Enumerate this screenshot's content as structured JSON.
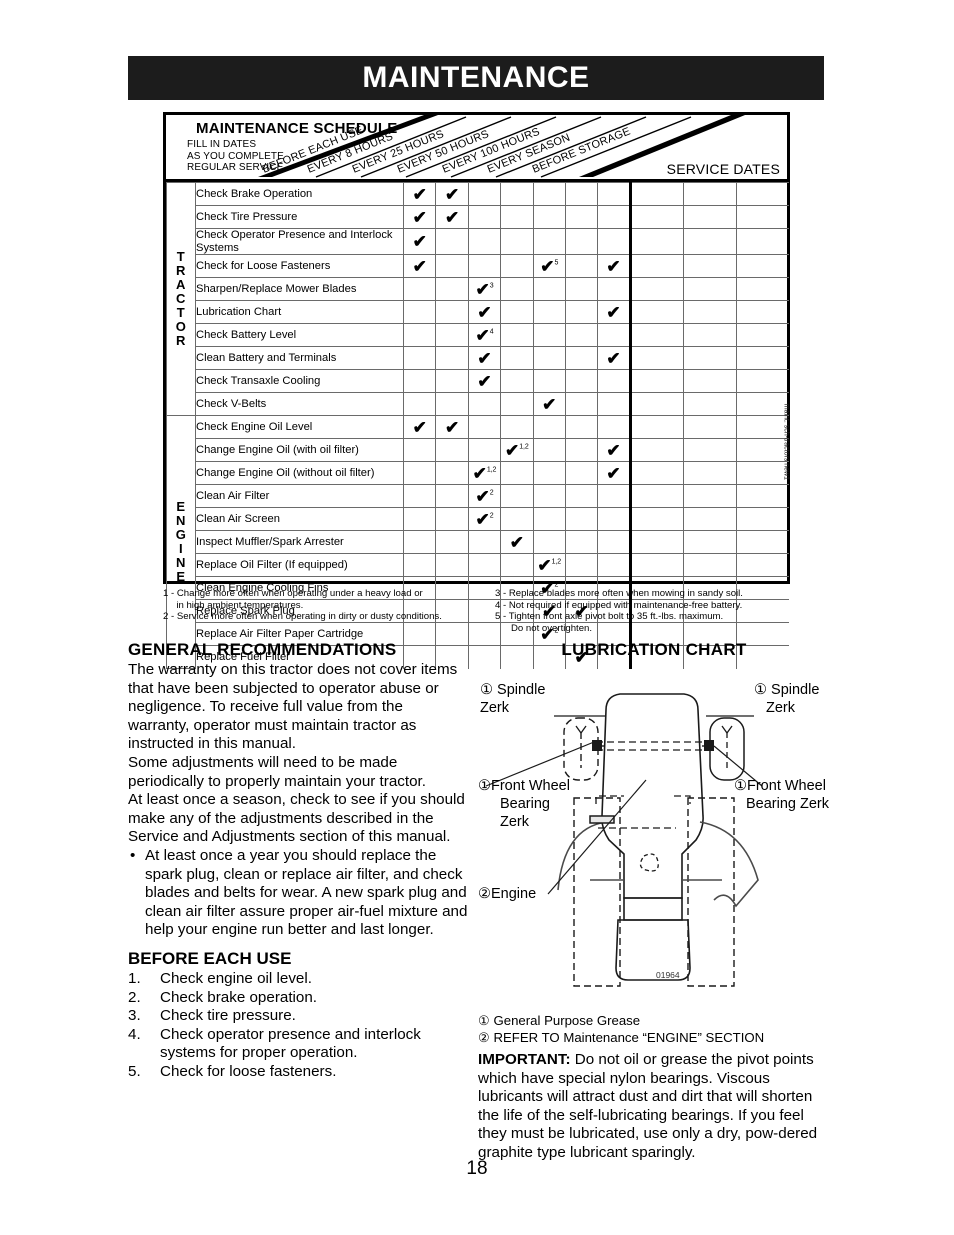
{
  "page": {
    "banner_title": "MAINTENANCE",
    "page_number": "18",
    "side_code": "maint. sch-tractors new1"
  },
  "schedule": {
    "title": "MAINTENANCE SCHEDULE",
    "subtitle_lines": [
      "FILL IN DATES",
      "AS YOU COMPLETE",
      "REGULAR SERVICE"
    ],
    "service_dates_label": "SERVICE DATES",
    "column_headers": [
      "BEFORE EACH USE",
      "EVERY 8 HOURS",
      "EVERY 25 HOURS",
      "EVERY 50 HOURS",
      "EVERY 100 HOURS",
      "EVERY SEASON",
      "BEFORE STORAGE"
    ],
    "sections": [
      {
        "label": "TRACTOR",
        "rows": [
          {
            "task": "Check Brake Operation",
            "checks": [
              {
                "col": 0
              },
              {
                "col": 1
              }
            ]
          },
          {
            "task": "Check Tire Pressure",
            "checks": [
              {
                "col": 0
              },
              {
                "col": 1
              }
            ]
          },
          {
            "task": "Check Operator Presence and Interlock Systems",
            "checks": [
              {
                "col": 0
              }
            ]
          },
          {
            "task": "Check for Loose Fasteners",
            "checks": [
              {
                "col": 0
              },
              {
                "col": 4,
                "note": "5"
              },
              {
                "col": 6
              }
            ]
          },
          {
            "task": "Sharpen/Replace Mower Blades",
            "checks": [
              {
                "col": 2,
                "note": "3"
              }
            ]
          },
          {
            "task": "Lubrication Chart",
            "checks": [
              {
                "col": 2
              },
              {
                "col": 6
              }
            ]
          },
          {
            "task": "Check Battery Level",
            "checks": [
              {
                "col": 2,
                "note": "4"
              }
            ]
          },
          {
            "task": "Clean Battery and Terminals",
            "checks": [
              {
                "col": 2
              },
              {
                "col": 6
              }
            ]
          },
          {
            "task": "Check Transaxle Cooling",
            "checks": [
              {
                "col": 2
              }
            ]
          },
          {
            "task": "Check V-Belts",
            "checks": [
              {
                "col": 4
              }
            ]
          }
        ]
      },
      {
        "label": "ENGINE",
        "rows": [
          {
            "task": "Check Engine Oil Level",
            "checks": [
              {
                "col": 0
              },
              {
                "col": 1
              }
            ]
          },
          {
            "task": "Change Engine Oil (with oil filter)",
            "checks": [
              {
                "col": 3,
                "note": "1,2"
              },
              {
                "col": 6
              }
            ]
          },
          {
            "task": "Change Engine Oil (without oil filter)",
            "checks": [
              {
                "col": 2,
                "note": "1,2"
              },
              {
                "col": 6
              }
            ]
          },
          {
            "task": "Clean Air Filter",
            "checks": [
              {
                "col": 2,
                "note": "2"
              }
            ]
          },
          {
            "task": "Clean Air Screen",
            "checks": [
              {
                "col": 2,
                "note": "2"
              }
            ]
          },
          {
            "task": "Inspect Muffler/Spark Arrester",
            "checks": [
              {
                "col": 3
              }
            ]
          },
          {
            "task": "Replace Oil Filter (If equipped)",
            "checks": [
              {
                "col": 4,
                "note": "1,2"
              }
            ]
          },
          {
            "task": "Clean Engine Cooling Fins",
            "checks": [
              {
                "col": 4,
                "note": "2"
              }
            ]
          },
          {
            "task": "Replace Spark Plug",
            "checks": [
              {
                "col": 4
              },
              {
                "col": 5
              }
            ]
          },
          {
            "task": "Replace Air Filter Paper Cartridge",
            "checks": [
              {
                "col": 4,
                "note": "2"
              }
            ]
          },
          {
            "task": "Replace Fuel Filter",
            "checks": [
              {
                "col": 5
              }
            ]
          }
        ]
      }
    ],
    "footnotes_left": [
      "1 - Change more often when operating under a heavy load or",
      "     in high ambient temperatures.",
      "2 - Service more often when operating in dirty or dusty conditions."
    ],
    "footnotes_right": [
      "3 - Replace blades more often when mowing in sandy soil.",
      "4 - Not required if equipped with maintenance-free battery.",
      "5 - Tighten front axle pivot bolt to 35 ft.-lbs. maximum.",
      "      Do not overtighten."
    ]
  },
  "general": {
    "heading": "GENERAL RECOMMENDATIONS",
    "paragraphs": [
      "The warranty on this tractor does not cover items that have been subjected to operator abuse or negligence.  To receive full value from the warranty, operator must maintain tractor as instructed in this manual.",
      "Some adjustments will need to be made periodically to properly maintain your tractor.",
      "At least once a season, check to see if you should make any of the adjustments described in the Service and Adjustments section of this manual."
    ],
    "bullets": [
      "At least once a year you should replace the spark plug, clean or replace air filter, and check blades and belts for wear. A new spark plug and clean air filter assure proper air-fuel mixture and help your engine run better and last longer."
    ]
  },
  "before_each_use": {
    "heading": "BEFORE EACH USE",
    "items": [
      {
        "num": "1.",
        "text": "Check engine oil level."
      },
      {
        "num": "2.",
        "text": "Check brake operation."
      },
      {
        "num": "3.",
        "text": "Check tire pressure."
      },
      {
        "num": "4.",
        "text": "Check operator presence and interlock systems for proper operation."
      },
      {
        "num": "5.",
        "text": "Check for loose fasteners."
      }
    ]
  },
  "lubrication": {
    "heading": "LUBRICATION CHART",
    "callouts": {
      "spindle_left": "① Spindle\nZerk",
      "spindle_right": "① Spindle\nZerk",
      "front_wheel_left": "①Front Wheel\n  Bearing\n  Zerk",
      "front_wheel_right": "①Front Wheel\n  Bearing Zerk",
      "engine": "②Engine",
      "drawing_code": "01964"
    },
    "legend": [
      "①  General Purpose Grease",
      "②  REFER TO Maintenance  “ENGINE” SECTION"
    ],
    "important_label": "IMPORTANT:",
    "important_text": "  Do not oil or grease the pivot points which have special nylon bearings.  Viscous lubricants will attract dust and dirt that will shorten the life of the self-lubricating bearings.  If you feel they must be lubricated, use only a dry, pow-dered graphite type lubricant sparingly."
  }
}
